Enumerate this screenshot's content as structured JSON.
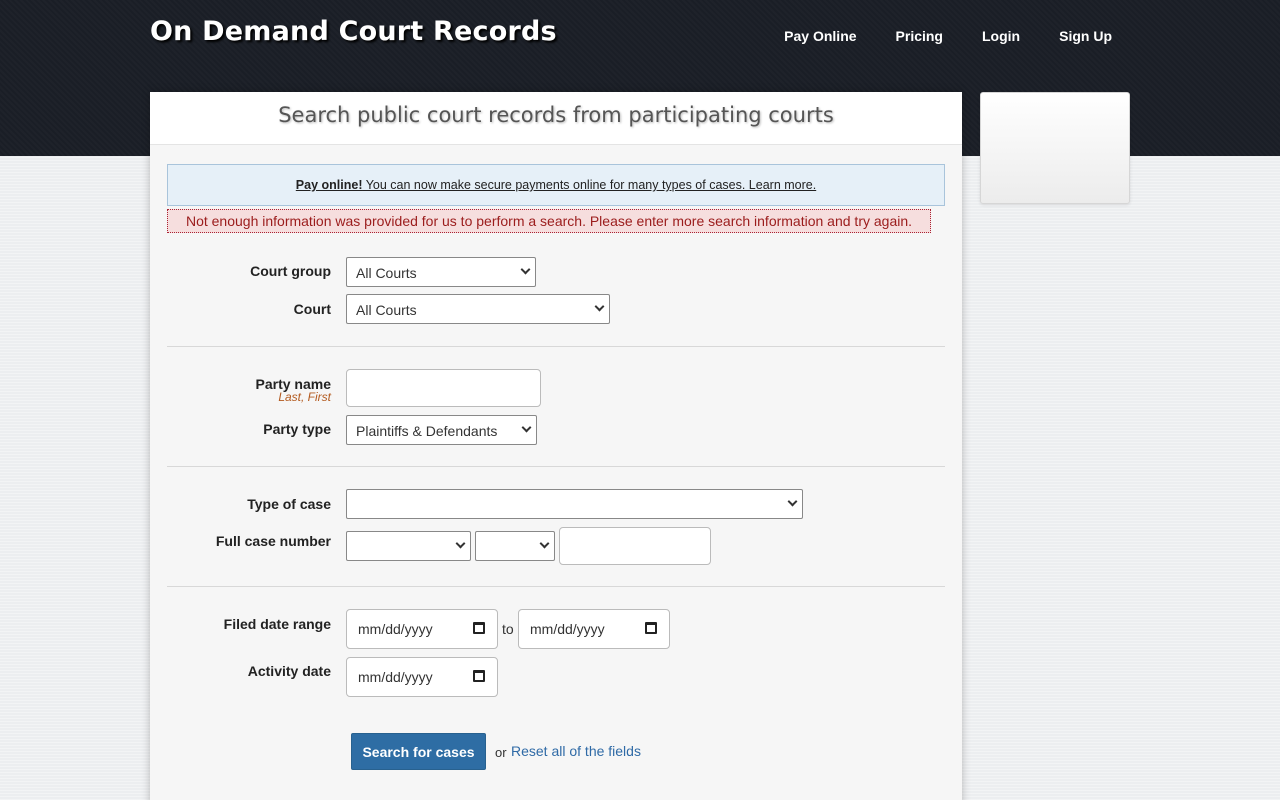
{
  "header": {
    "brand": "On Demand Court Records",
    "nav": [
      "Pay Online",
      "Pricing",
      "Login",
      "Sign Up"
    ]
  },
  "panel": {
    "title": "Search public court records from participating courts"
  },
  "info": {
    "link_bold": "Pay online!",
    "link_rest": " You can now make secure payments online for many types of cases. Learn more."
  },
  "error": "Not enough information was provided for us to perform a search. Please enter more search information and try again.",
  "form": {
    "court_group_label": "Court group",
    "court_group_value": "All Courts",
    "court_label": "Court",
    "court_value": "All Courts",
    "party_name_label": "Party name",
    "party_name_hint": "Last, First",
    "party_name_value": "",
    "party_type_label": "Party type",
    "party_type_value": "Plaintiffs & Defendants",
    "case_type_label": "Type of case",
    "case_type_value": "",
    "case_number_label": "Full case number",
    "case_number_part1": "",
    "case_number_part2": "",
    "case_number_part3": "",
    "filed_range_label": "Filed date range",
    "date_placeholder": "mm/dd/yyyy",
    "to_word": "to",
    "activity_label": "Activity date",
    "search_button": "Search for cases",
    "or_word": "or",
    "reset_link": "Reset all of the fields"
  },
  "colors": {
    "header_bg": "#1b1f27",
    "button_bg": "#2e6da4",
    "link": "#2f6aa6",
    "error_text": "#9b1c1c",
    "info_bg": "#e6f0f8"
  }
}
